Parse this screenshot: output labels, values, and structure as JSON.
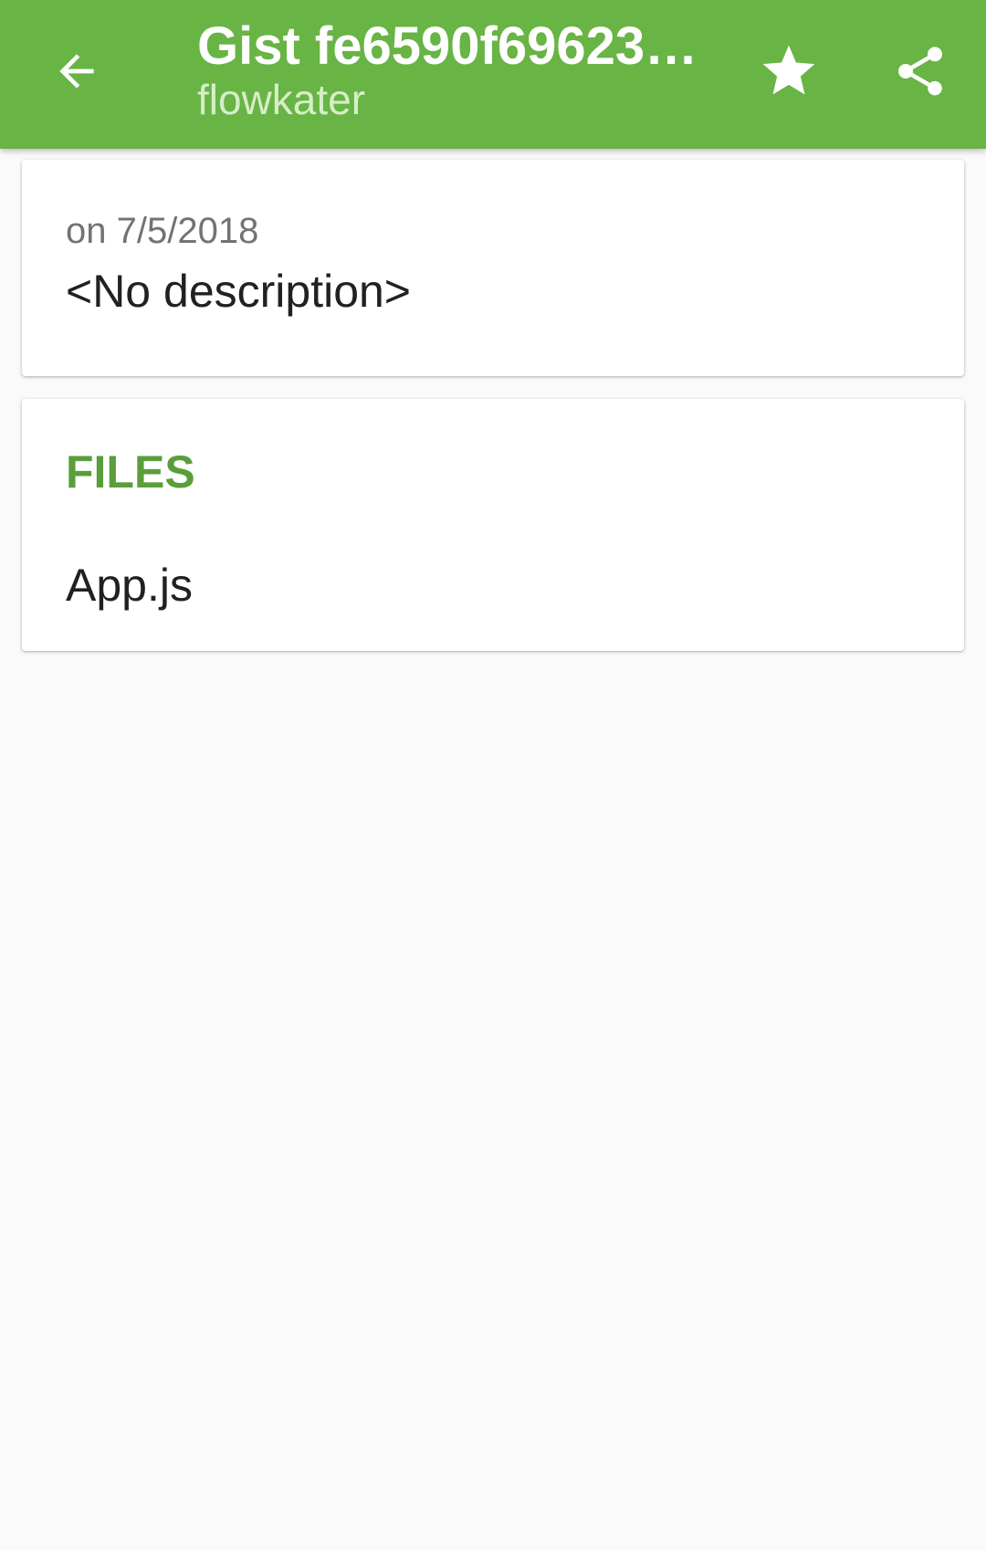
{
  "app_bar": {
    "title": "Gist fe6590f69623…",
    "subtitle": "flowkater",
    "background_color": "#68b445",
    "icons": {
      "back": "arrow-back-icon",
      "star": "star-icon",
      "share": "share-icon"
    }
  },
  "gist_info": {
    "date": "on 7/5/2018",
    "description": "<No description>"
  },
  "files": {
    "heading": "FILES",
    "heading_color": "#5a9e3b",
    "items": [
      {
        "name": "App.js"
      }
    ]
  }
}
